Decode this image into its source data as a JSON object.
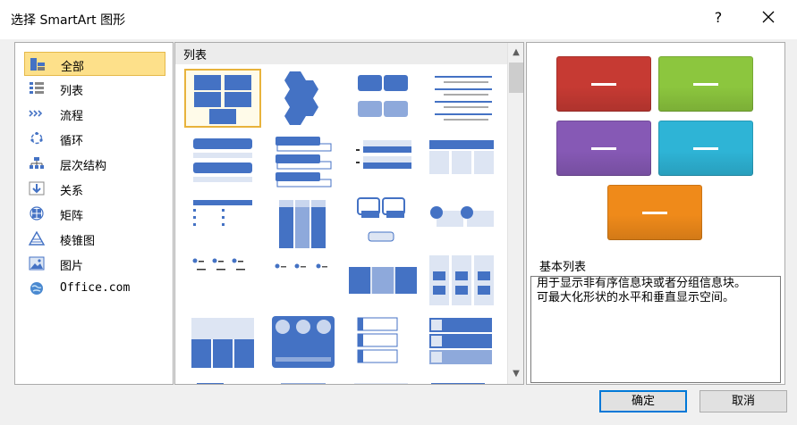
{
  "title": "选择 SmartArt 图形",
  "title_help": "?",
  "categories": [
    {
      "label": "全部",
      "icon": "all-icon"
    },
    {
      "label": "列表",
      "icon": "list-icon"
    },
    {
      "label": "流程",
      "icon": "process-icon"
    },
    {
      "label": "循环",
      "icon": "cycle-icon"
    },
    {
      "label": "层次结构",
      "icon": "hierarchy-icon"
    },
    {
      "label": "关系",
      "icon": "relationship-icon"
    },
    {
      "label": "矩阵",
      "icon": "matrix-icon"
    },
    {
      "label": "棱锥图",
      "icon": "pyramid-icon"
    },
    {
      "label": "图片",
      "icon": "picture-icon"
    },
    {
      "label": "Office.com",
      "icon": "office-com-icon"
    }
  ],
  "selected_category": "全部",
  "gallery_header": "列表",
  "preview": {
    "colors": [
      "#c63a33",
      "#8cc63e",
      "#8659b5",
      "#2eb4d6",
      "#ef8a1a"
    ]
  },
  "description": {
    "title": "基本列表",
    "text_line1": "用于显示非有序信息块或者分组信息块。",
    "text_line2": "可最大化形状的水平和垂直显示空间。"
  },
  "buttons": {
    "ok": "确定",
    "cancel": "取消"
  },
  "colors": {
    "accent_blue": "#4472c4",
    "selection": "#fde08a",
    "selection_border": "#e5b94a"
  }
}
